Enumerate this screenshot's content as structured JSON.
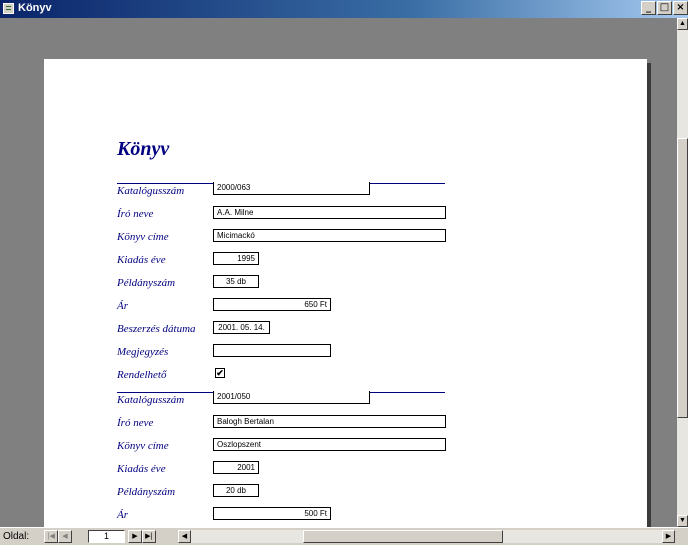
{
  "window": {
    "title": "Könyv",
    "minimize": "_",
    "restore": "□",
    "close": "×"
  },
  "report": {
    "title": "Könyv",
    "labels": {
      "katalogusszam": "Katalógusszám",
      "iro": "Író neve",
      "cim": "Könyv címe",
      "kiadas": "Kiadás éve",
      "peldanyszam": "Példányszám",
      "ar": "Ár",
      "beszerzes": "Beszerzés dátuma",
      "megjegyzes": "Megjegyzés",
      "rendelheto": "Rendelhető"
    },
    "records": [
      {
        "katalogusszam": "2000/063",
        "iro": "A.A. Milne",
        "cim": "Micimackó",
        "kiadas": "1995",
        "peldanyszam": "35 db",
        "ar": "650 Ft",
        "beszerzes": "2001. 05. 14.",
        "megjegyzes": "",
        "rendelheto": "✔"
      },
      {
        "katalogusszam": "2001/050",
        "iro": "Balogh Bertalan",
        "cim": "Oszlopszent",
        "kiadas": "2001",
        "peldanyszam": "20 db",
        "ar": "500 Ft"
      }
    ]
  },
  "status": {
    "oldal_label": "Oldal:",
    "page": "1",
    "first": "|◀",
    "prev": "◀",
    "next": "▶",
    "last": "▶|"
  }
}
